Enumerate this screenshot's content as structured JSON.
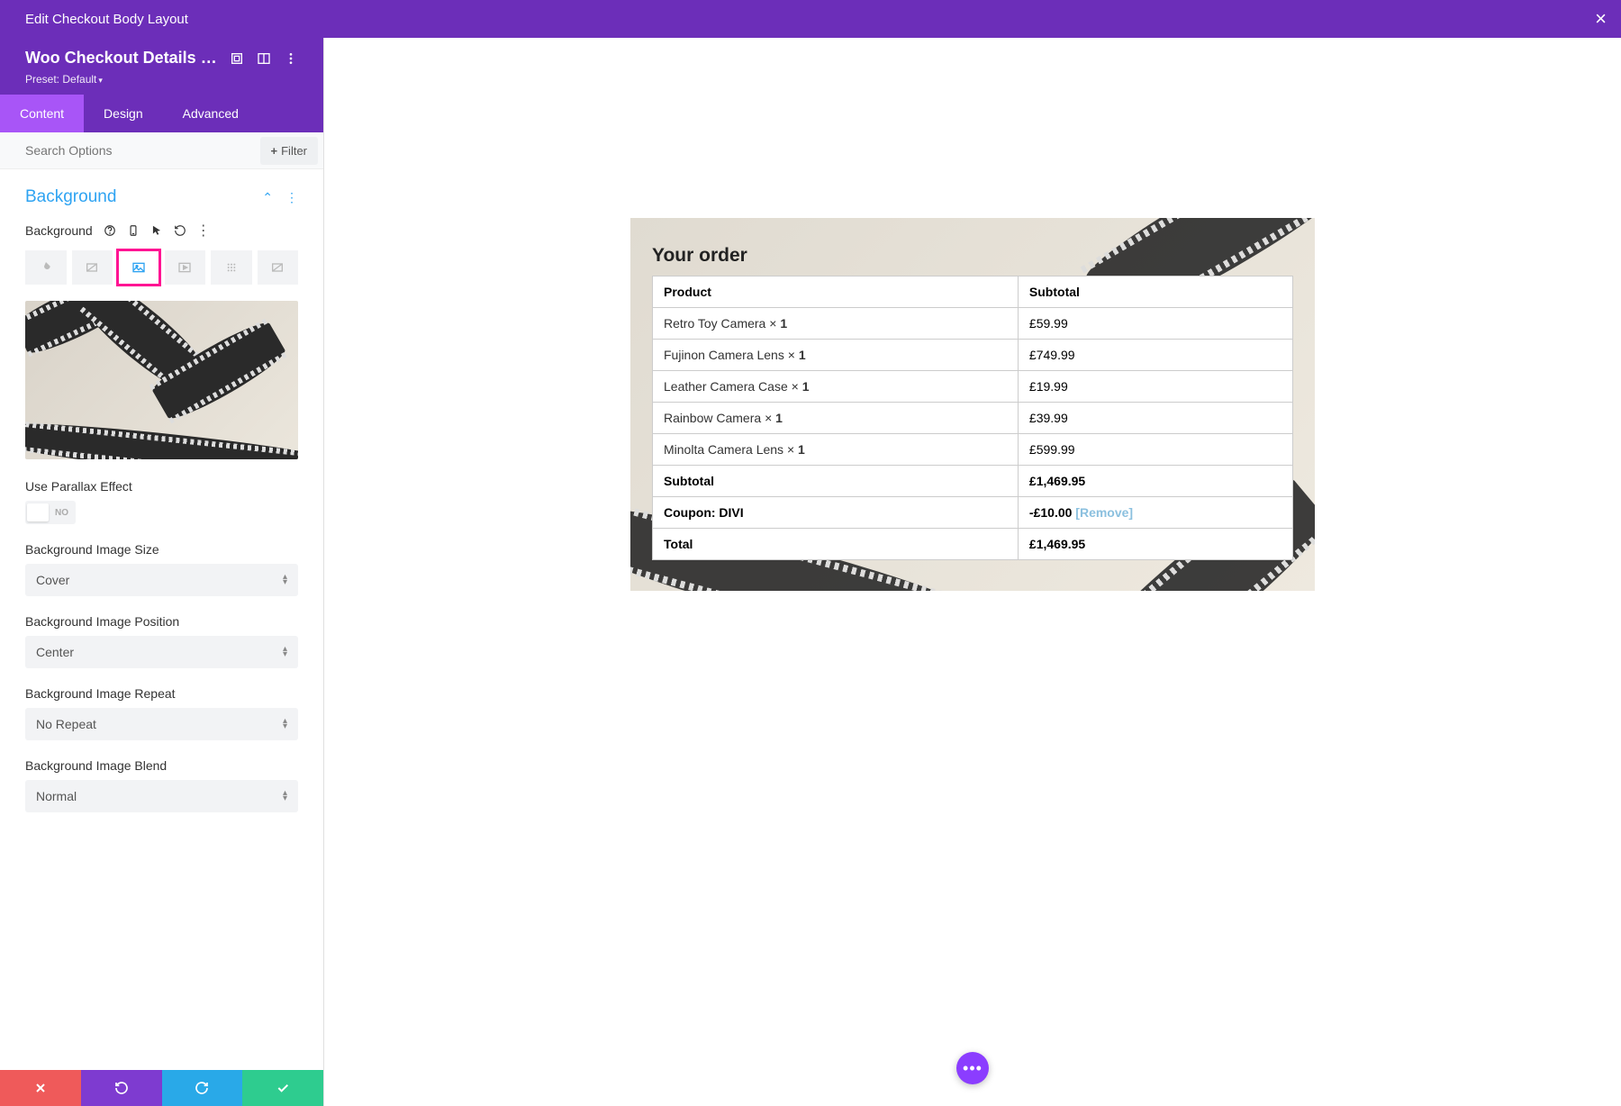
{
  "topbar": {
    "title": "Edit Checkout Body Layout"
  },
  "settings_header": {
    "title": "Woo Checkout Details Setti...",
    "preset_label": "Preset:",
    "preset_value": "Default"
  },
  "tabs": {
    "content": "Content",
    "design": "Design",
    "advanced": "Advanced"
  },
  "search": {
    "placeholder": "Search Options",
    "filter_label": "Filter"
  },
  "section": {
    "title": "Background",
    "field_label": "Background"
  },
  "parallax": {
    "label": "Use Parallax Effect",
    "value": "NO"
  },
  "bg_size": {
    "label": "Background Image Size",
    "value": "Cover"
  },
  "bg_position": {
    "label": "Background Image Position",
    "value": "Center"
  },
  "bg_repeat": {
    "label": "Background Image Repeat",
    "value": "No Repeat"
  },
  "bg_blend": {
    "label": "Background Image Blend",
    "value": "Normal"
  },
  "order": {
    "heading": "Your order",
    "col_product": "Product",
    "col_subtotal": "Subtotal",
    "items": [
      {
        "name": "Retro Toy Camera",
        "qty": "1",
        "price": "£59.99"
      },
      {
        "name": "Fujinon Camera Lens",
        "qty": "1",
        "price": "£749.99"
      },
      {
        "name": "Leather Camera Case",
        "qty": "1",
        "price": "£19.99"
      },
      {
        "name": "Rainbow Camera",
        "qty": "1",
        "price": "£39.99"
      },
      {
        "name": "Minolta Camera Lens",
        "qty": "1",
        "price": "£599.99"
      }
    ],
    "subtotal_label": "Subtotal",
    "subtotal_value": "£1,469.95",
    "coupon_label": "Coupon: DIVI",
    "coupon_value": "-£10.00",
    "coupon_remove": "[Remove]",
    "total_label": "Total",
    "total_value": "£1,469.95"
  }
}
